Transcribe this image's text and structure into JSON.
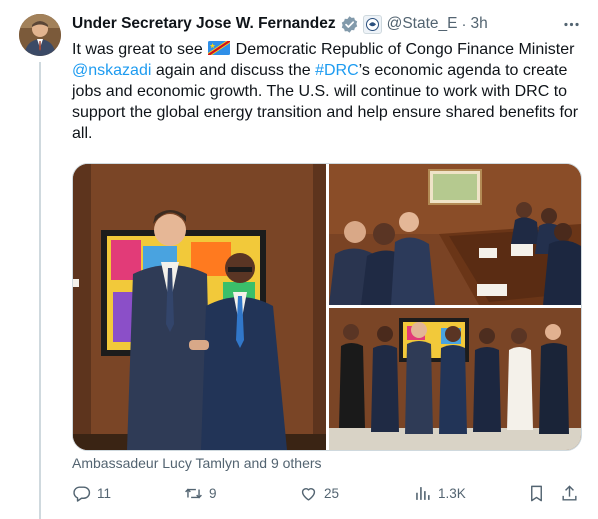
{
  "tweet": {
    "author_name": "Under Secretary Jose W. Fernandez",
    "handle": "@State_E",
    "separator": "·",
    "time": "3h",
    "text_parts": {
      "p1": "It was great to see ",
      "p2": " Democratic Republic of Congo Finance Minister ",
      "mention": "@nskazadi",
      "p3": " again and discuss the ",
      "hashtag": "#DRC",
      "p4": "’s economic agenda to create jobs and economic growth. The U.S. will continue to work with DRC to support the global energy transition and help ensure shared benefits for all."
    },
    "tagged_people": "Ambassadeur Lucy Tamlyn and 9 others"
  },
  "actions": {
    "reply_count": "11",
    "retweet_count": "9",
    "like_count": "25",
    "views_count": "1.3K"
  },
  "icons": {
    "verified": "verified-badge-icon",
    "org": "state-dept-seal-icon",
    "more": "more-options-icon",
    "flag": "drc-flag-icon",
    "reply": "reply-icon",
    "retweet": "retweet-icon",
    "like": "like-icon",
    "views": "views-icon",
    "bookmark": "bookmark-icon",
    "share": "share-icon"
  },
  "colors": {
    "link": "#1d9bf0",
    "secondary_text": "#536471",
    "verified": "#1d9bf0"
  }
}
